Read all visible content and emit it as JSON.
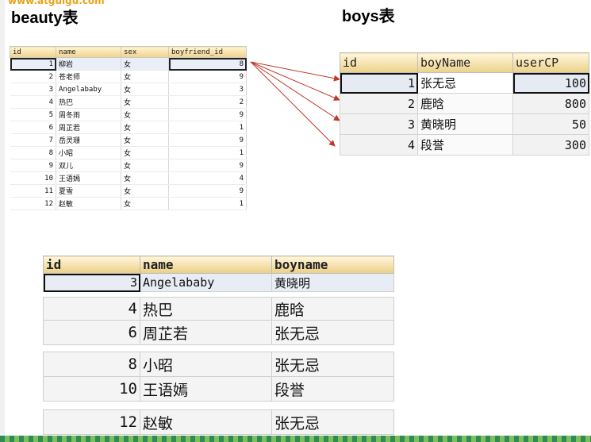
{
  "watermark": "www.atguigu.com",
  "beauty_title": "beauty表",
  "boys_title": "boys表",
  "beauty_table": {
    "headers": [
      "id",
      "name",
      "sex",
      "boyfriend_id"
    ],
    "rows": [
      [
        "1",
        "柳岩",
        "女",
        "8"
      ],
      [
        "2",
        "苍老师",
        "女",
        "9"
      ],
      [
        "3",
        "Angelababy",
        "女",
        "3"
      ],
      [
        "4",
        "热巴",
        "女",
        "2"
      ],
      [
        "5",
        "周冬雨",
        "女",
        "9"
      ],
      [
        "6",
        "周芷若",
        "女",
        "1"
      ],
      [
        "7",
        "岳灵珊",
        "女",
        "9"
      ],
      [
        "8",
        "小昭",
        "女",
        "1"
      ],
      [
        "9",
        "双儿",
        "女",
        "9"
      ],
      [
        "10",
        "王语嫣",
        "女",
        "4"
      ],
      [
        "11",
        "夏雪",
        "女",
        "9"
      ],
      [
        "12",
        "赵敏",
        "女",
        "1"
      ]
    ]
  },
  "boys_table": {
    "headers": [
      "id",
      "boyName",
      "userCP"
    ],
    "rows": [
      [
        "1",
        "张无忌",
        "100"
      ],
      [
        "2",
        "鹿晗",
        "800"
      ],
      [
        "3",
        "黄晓明",
        "50"
      ],
      [
        "4",
        "段誉",
        "300"
      ]
    ]
  },
  "result_table": {
    "headers": [
      "id",
      "name",
      "boyname"
    ],
    "rows": [
      [
        "3",
        "Angelababy",
        "黄晓明"
      ],
      [
        "4",
        "热巴",
        "鹿晗"
      ],
      [
        "6",
        "周芷若",
        "张无忌"
      ],
      [
        "8",
        "小昭",
        "张无忌"
      ],
      [
        "10",
        "王语嫣",
        "段誉"
      ],
      [
        "12",
        "赵敏",
        "张无忌"
      ]
    ]
  },
  "colors": {
    "arrow": "#c0392b",
    "header_gradient_top": "#fff3cf",
    "header_gradient_bottom": "#f0d38a",
    "selection": "#e9eef7"
  }
}
